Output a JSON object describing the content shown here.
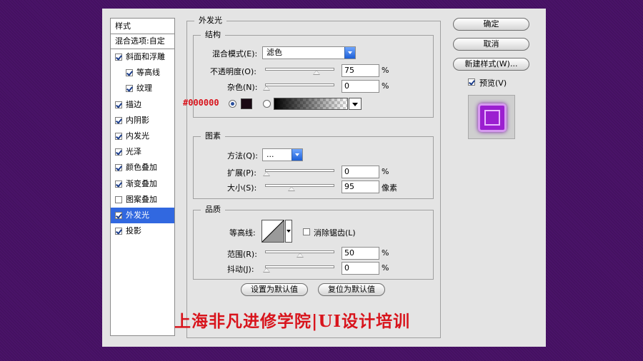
{
  "left_panel": {
    "title": "样式",
    "blend_options": "混合选项:自定",
    "items": [
      {
        "label": "斜面和浮雕",
        "checked": true,
        "indent": false,
        "selected": false
      },
      {
        "label": "等高线",
        "checked": true,
        "indent": true,
        "selected": false
      },
      {
        "label": "纹理",
        "checked": true,
        "indent": true,
        "selected": false
      },
      {
        "label": "描边",
        "checked": true,
        "indent": false,
        "selected": false
      },
      {
        "label": "内阴影",
        "checked": true,
        "indent": false,
        "selected": false
      },
      {
        "label": "内发光",
        "checked": true,
        "indent": false,
        "selected": false
      },
      {
        "label": "光泽",
        "checked": true,
        "indent": false,
        "selected": false
      },
      {
        "label": "颜色叠加",
        "checked": true,
        "indent": false,
        "selected": false
      },
      {
        "label": "渐变叠加",
        "checked": true,
        "indent": false,
        "selected": false
      },
      {
        "label": "图案叠加",
        "checked": false,
        "indent": false,
        "selected": false
      },
      {
        "label": "外发光",
        "checked": true,
        "indent": false,
        "selected": true
      },
      {
        "label": "投影",
        "checked": true,
        "indent": false,
        "selected": false
      }
    ]
  },
  "panel_title": "外发光",
  "structure": {
    "title": "结构",
    "blend_mode_label": "混合模式(E):",
    "blend_mode_value": "滤色",
    "opacity_label": "不透明度(O):",
    "opacity_value": "75",
    "opacity_fraction": 0.75,
    "noise_label": "杂色(N):",
    "noise_value": "0",
    "noise_fraction": 0.0,
    "percent": "%",
    "color_hex_annotation": "#000000",
    "glow_color": "#1a0a14"
  },
  "elements": {
    "title": "图素",
    "technique_label": "方法(Q):",
    "technique_value": "...",
    "spread_label": "扩展(P):",
    "spread_value": "0",
    "spread_fraction": 0.0,
    "size_label": "大小(S):",
    "size_value": "95",
    "size_fraction": 0.38,
    "size_unit": "像素",
    "percent": "%"
  },
  "quality": {
    "title": "品质",
    "contour_label": "等高线:",
    "antialias_label": "消除锯齿(L)",
    "antialias_checked": false,
    "range_label": "范围(R):",
    "range_value": "50",
    "range_fraction": 0.5,
    "jitter_label": "抖动(J):",
    "jitter_value": "0",
    "jitter_fraction": 0.0,
    "percent": "%"
  },
  "buttons": {
    "make_default": "设置为默认值",
    "reset_default": "复位为默认值",
    "ok": "确定",
    "cancel": "取消",
    "new_style": "新建样式(W)...",
    "preview_label": "预览(V)",
    "preview_checked": true
  },
  "watermark": "上海非凡进修学院|UI设计培训",
  "colors": {
    "background": "#4a1368",
    "selection": "#3168e0",
    "accent_blue": "#1c5fd6",
    "watermark_red": "#d8141c",
    "preview_purple": "#9b1fd0"
  }
}
